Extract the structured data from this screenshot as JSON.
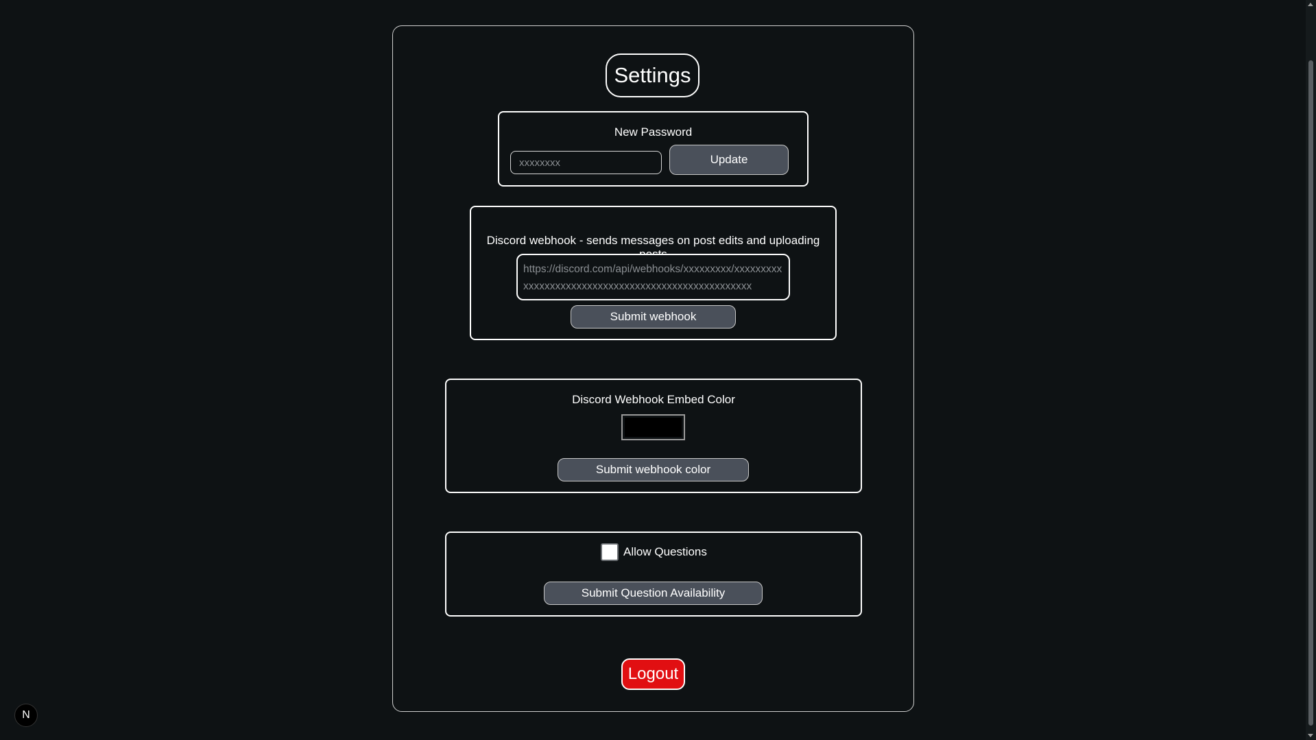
{
  "settings": {
    "title": "Settings",
    "password": {
      "label": "New Password",
      "placeholder": "xxxxxxxx",
      "update_label": "Update"
    },
    "webhook": {
      "label": "Discord webhook - sends messages on post edits and uploading posts",
      "placeholder": "https://discord.com/api/webhooks/xxxxxxxxx/xxxxxxxxxxxxxxxxxxxxxxxxxxxxxxxxxxxxxxxxxxxxxxxxxxxx",
      "submit_label": "Submit webhook"
    },
    "embed_color": {
      "label": "Discord Webhook Embed Color",
      "value": "#000000",
      "submit_label": "Submit webhook color"
    },
    "questions": {
      "checkbox_label": "Allow Questions",
      "checked": false,
      "submit_label": "Submit Question Availability"
    },
    "logout_label": "Logout"
  },
  "dev_badge": {
    "label": "N"
  }
}
